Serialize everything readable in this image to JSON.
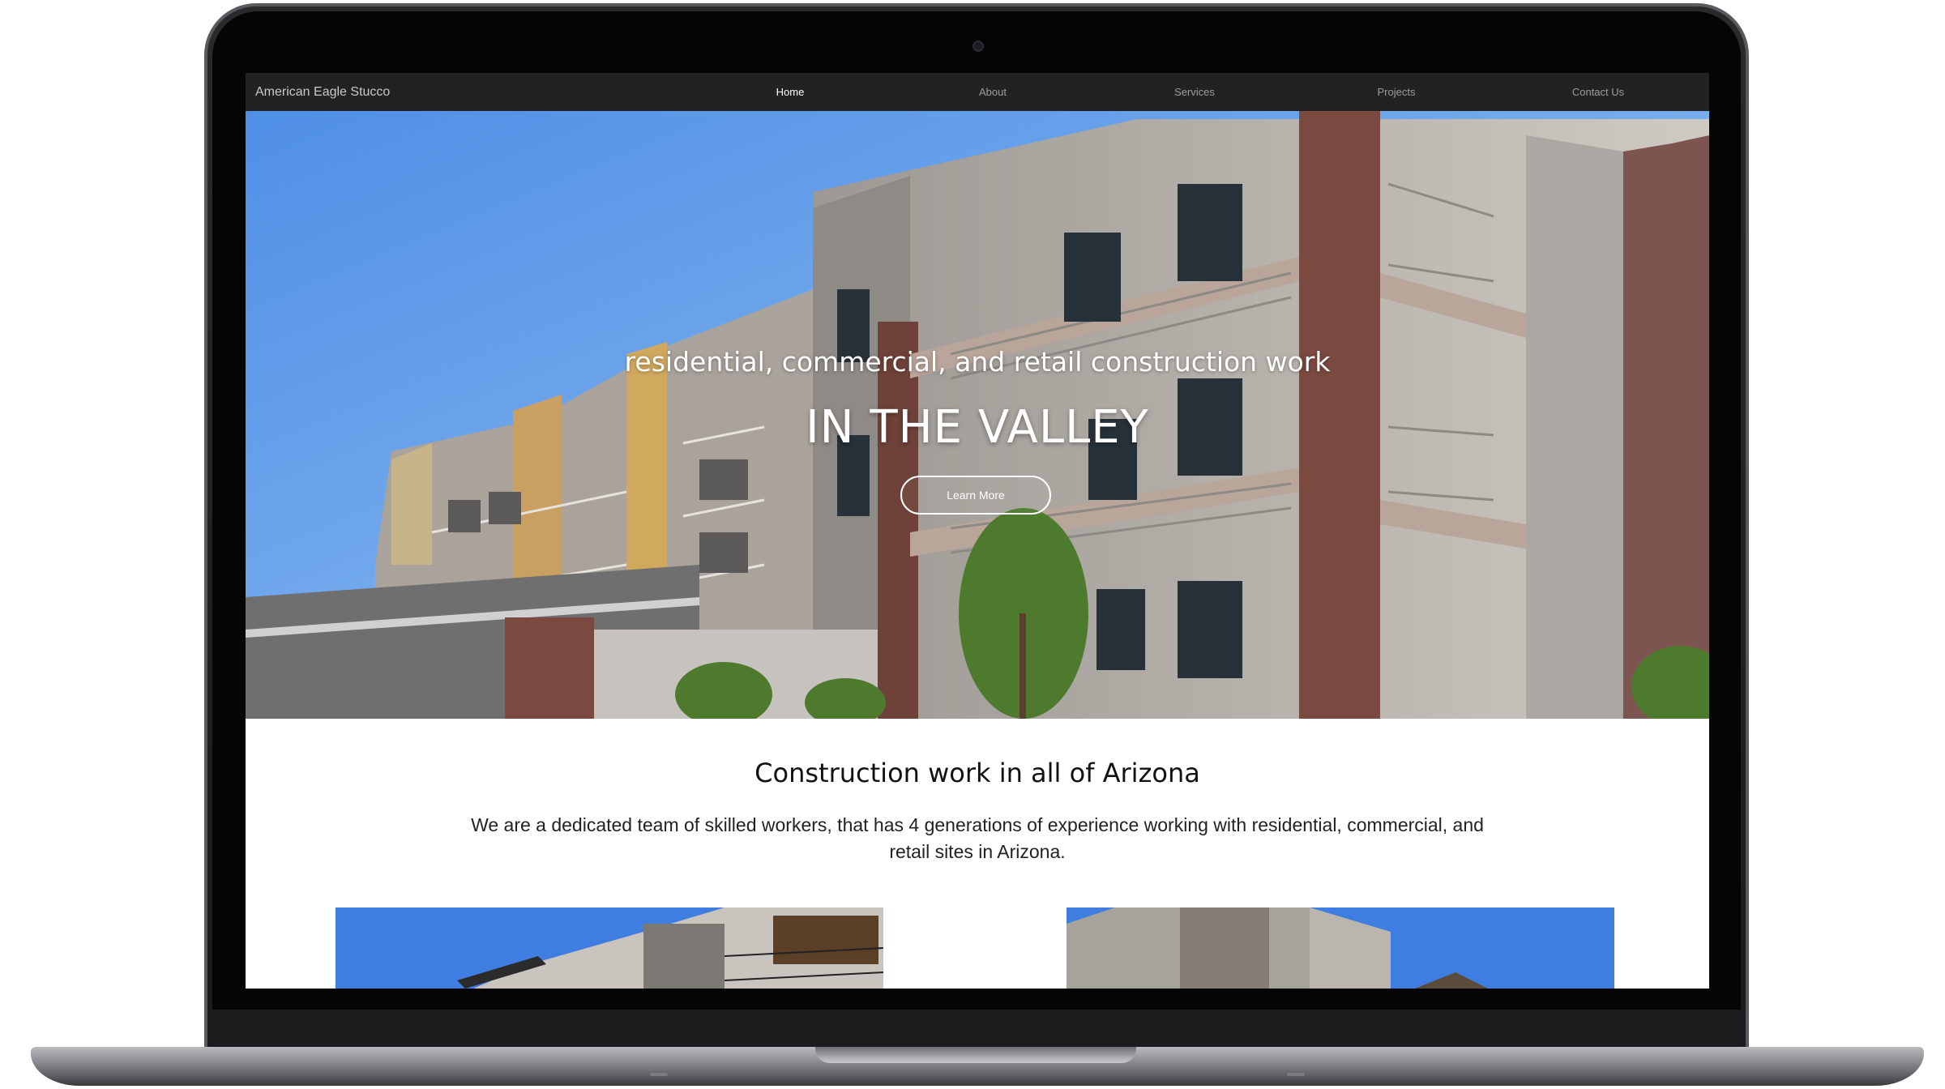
{
  "nav": {
    "brand": "American Eagle Stucco",
    "items": [
      {
        "label": "Home",
        "active": true
      },
      {
        "label": "About",
        "active": false
      },
      {
        "label": "Services",
        "active": false
      },
      {
        "label": "Projects",
        "active": false
      },
      {
        "label": "Contact Us",
        "active": false
      }
    ]
  },
  "hero": {
    "subtitle": "residential, commercial, and retail construction work",
    "title": "IN THE VALLEY",
    "button_label": "Learn More"
  },
  "intro": {
    "heading": "Construction work in all of Arizona",
    "body": "We are a dedicated team of skilled workers, that has 4 generations of experience working with residential, commercial, and retail sites in Arizona."
  },
  "colors": {
    "navbar": "#222222",
    "sky": "#5d9ae8",
    "stucco": "#c9c4bd",
    "brick": "#7a4a40"
  }
}
